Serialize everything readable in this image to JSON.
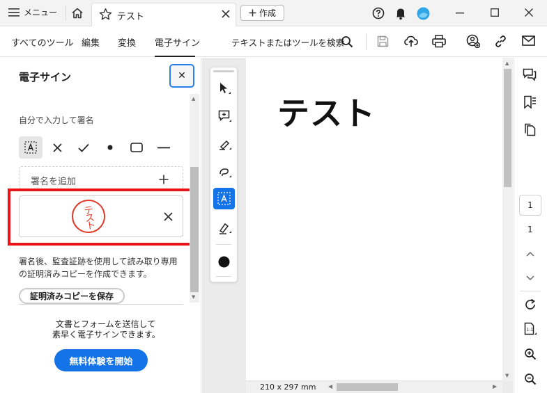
{
  "titlebar": {
    "menu_label": "メニュー",
    "tab_title": "テスト",
    "new_label": "作成"
  },
  "toolbar": {
    "tabs": [
      "すべてのツール",
      "編集",
      "変換",
      "電子サイン"
    ],
    "active_tab": "電子サイン",
    "search_label": "テキストまたはツールを検索"
  },
  "panel": {
    "title": "電子サイン",
    "section_label": "自分で入力して署名",
    "tools": [
      "text-field-icon",
      "cross-icon",
      "check-icon",
      "dot-icon",
      "rectangle-icon",
      "line-icon"
    ],
    "add_signature_label": "署名を追加",
    "signature_stamp_text": "テスト",
    "info_text_line1": "署名後、監査証跡を使用して読み取り専用",
    "info_text_line2": "の証明済みコピーを作成できます。",
    "save_copy_label": "証明済みコピーを保存",
    "promo_line1": "文書とフォームを送信して",
    "promo_line2": "素早く電子サインできます。",
    "trial_button_label": "無料体験を開始"
  },
  "document": {
    "heading": "テスト",
    "page_size": "210 x 297 mm"
  },
  "page_nav": {
    "current_page": "1",
    "total_pages": "1"
  },
  "colors": {
    "accent": "#1473e6",
    "highlight": "#e8141a",
    "stamp": "#e03a2a"
  }
}
